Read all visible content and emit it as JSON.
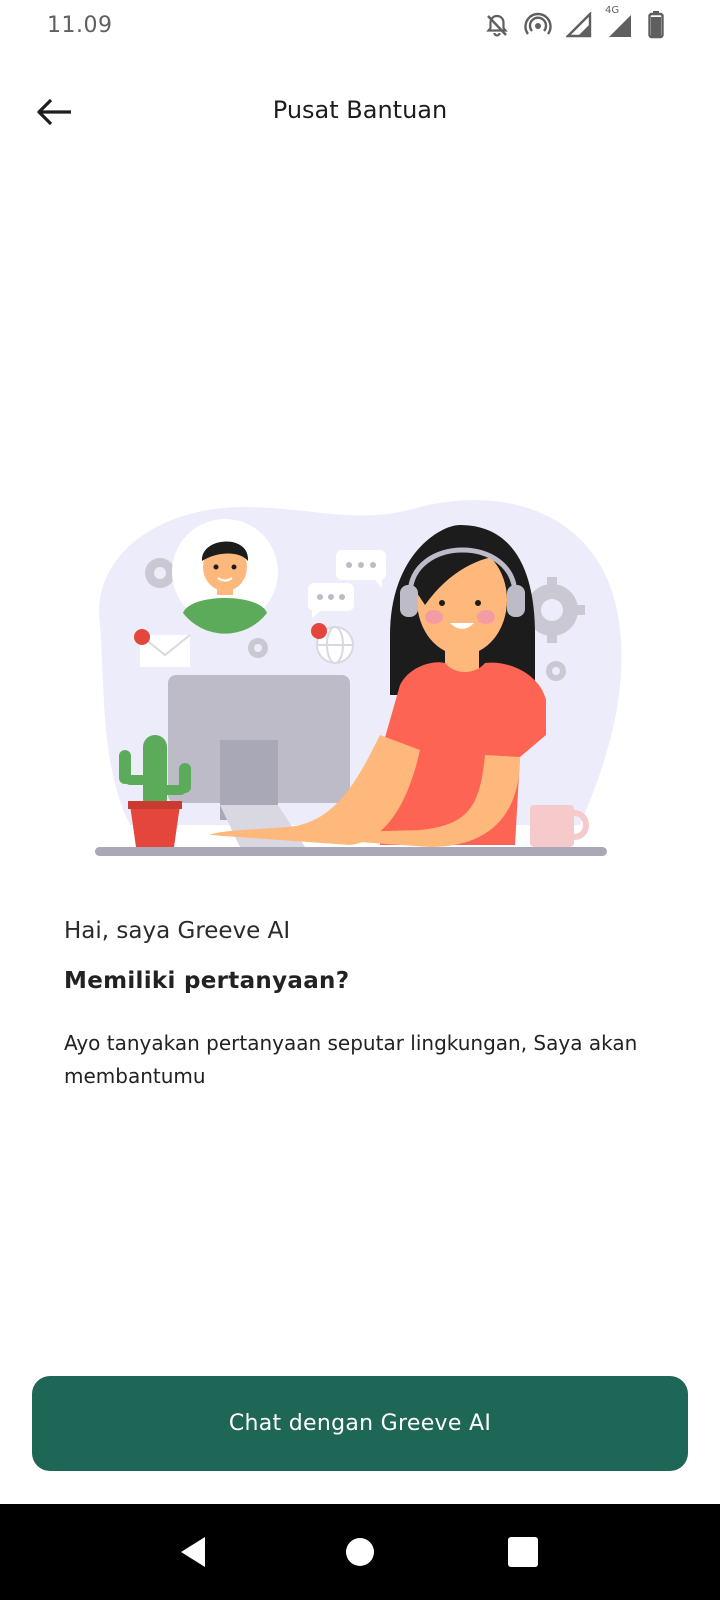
{
  "status_bar": {
    "time": "11.09",
    "icons": [
      "notifications-off-icon",
      "hotspot-icon",
      "signal-icon",
      "signal-4g-icon",
      "battery-icon"
    ],
    "network_label": "4G"
  },
  "header": {
    "title": "Pusat Bantuan",
    "back_icon": "arrow-left-icon"
  },
  "illustration": {
    "name": "customer-support-illustration",
    "colors": {
      "blob": "#ececfb",
      "shirt": "#fd6453",
      "skin": "#ffb87c",
      "hair": "#1c1c1c",
      "monitor": "#bcbbc7",
      "cactus": "#5cab5b",
      "pot": "#e5463c",
      "mug": "#f6c9cb",
      "desk": "#a9a8b7",
      "gear": "#c9c8d3"
    }
  },
  "content": {
    "greeting": "Hai, saya Greeve AI",
    "question": "Memiliki pertanyaan?",
    "description": "Ayo tanyakan pertanyaan seputar lingkungan, Saya akan membantumu"
  },
  "cta": {
    "label": "Chat dengan Greeve AI",
    "color": "#1e6756"
  },
  "nav_bar": {
    "buttons": [
      "back-icon",
      "home-icon",
      "recents-icon"
    ]
  }
}
